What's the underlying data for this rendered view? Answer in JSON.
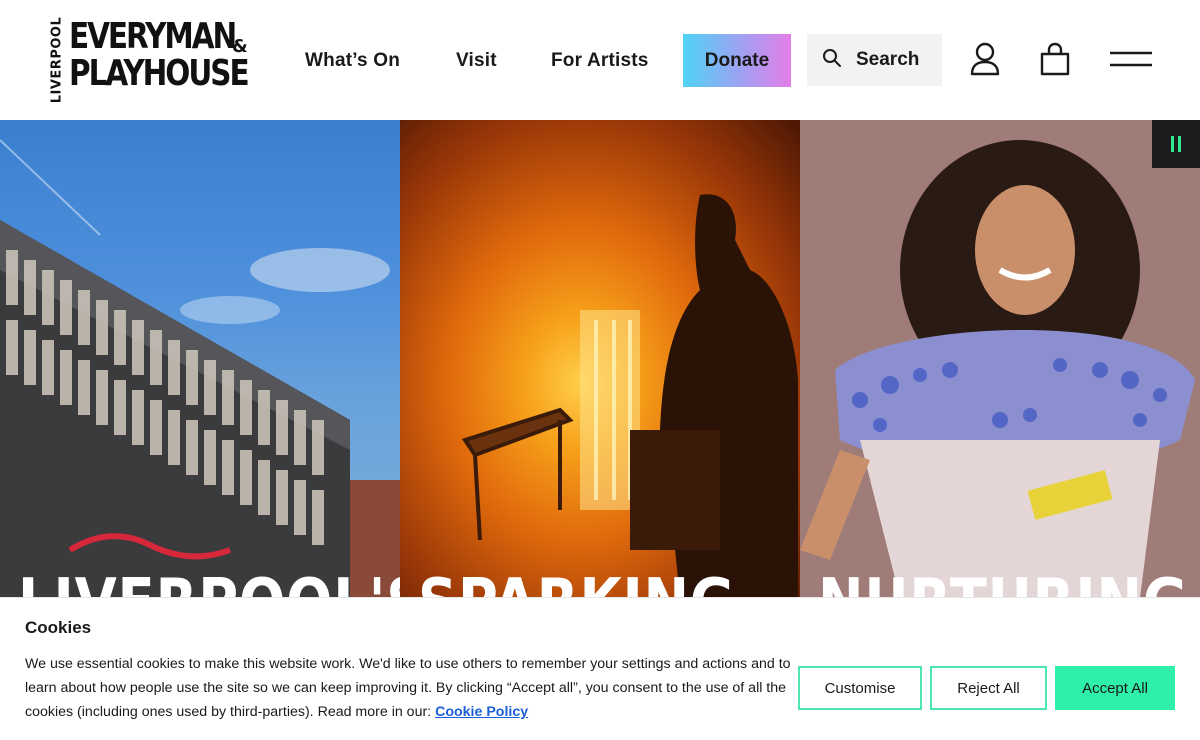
{
  "logo": {
    "vertical": "LIVERPOOL",
    "line1": "EVERYMAN",
    "amp": "&",
    "line2": "PLAYHOUSE"
  },
  "nav": {
    "whats_on": "What’s On",
    "visit": "Visit",
    "for_artists": "For Artists",
    "donate": "Donate",
    "search": "Search"
  },
  "hero": {
    "panels": [
      {
        "word": "LIVERPOOL'S"
      },
      {
        "word": "SPARKING"
      },
      {
        "word": "NURTURING"
      }
    ]
  },
  "cookie": {
    "title": "Cookies",
    "text": "We use essential cookies to make this website work. We'd like to use others to remember your settings and actions and to learn about how people use the site so we can keep improving it. By clicking “Accept all”, you consent to the use of all the cookies (including ones used by third-parties). Read more in our:",
    "link": "Cookie Policy",
    "customise": "Customise",
    "reject": "Reject All",
    "accept": "Accept All"
  },
  "colors": {
    "accent_green": "#2ff0a8",
    "donate_gradient_start": "#4fd3f5",
    "donate_gradient_end": "#e37ee8",
    "link_blue": "#1a5fd6"
  }
}
